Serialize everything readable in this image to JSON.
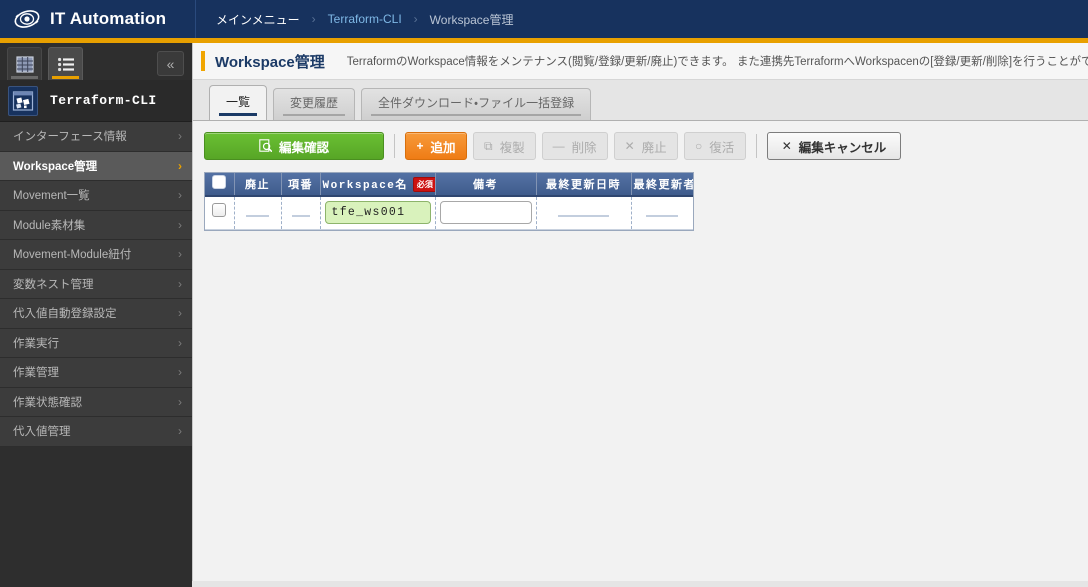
{
  "header": {
    "brand": "IT Automation",
    "logo_icon": "eye-logo-icon",
    "breadcrumb": [
      {
        "label": "メインメニュー",
        "kind": "plain"
      },
      {
        "label": "Terraform-CLI",
        "kind": "link"
      },
      {
        "label": "Workspace管理",
        "kind": "current"
      }
    ],
    "separator": "›"
  },
  "sidebar": {
    "tabs": [
      {
        "icon": "grid-view-icon",
        "active": false
      },
      {
        "icon": "list-view-icon",
        "active": true
      }
    ],
    "collapse_icon": "«",
    "section": {
      "icon": "terraform-cli-icon",
      "label": "Terraform-CLI"
    },
    "chevron": "›",
    "items": [
      {
        "label": "インターフェース情報",
        "active": false
      },
      {
        "label": "Workspace管理",
        "active": true
      },
      {
        "label": "Movement一覧",
        "active": false
      },
      {
        "label": "Module素材集",
        "active": false
      },
      {
        "label": "Movement-Module紐付",
        "active": false
      },
      {
        "label": "変数ネスト管理",
        "active": false
      },
      {
        "label": "代入値自動登録設定",
        "active": false
      },
      {
        "label": "作業実行",
        "active": false
      },
      {
        "label": "作業管理",
        "active": false
      },
      {
        "label": "作業状態確認",
        "active": false
      },
      {
        "label": "代入値管理",
        "active": false
      }
    ]
  },
  "page": {
    "title": "Workspace管理",
    "description": "TerraformのWorkspace情報をメンテナンス(閲覧/登録/更新/廃止)できます。 また連携先TerraformへWorkspacenの[登録/更新/削除]を行うことができます"
  },
  "tabs": [
    {
      "label": "一覧",
      "active": true
    },
    {
      "label": "変更履歴",
      "active": false
    },
    {
      "label": "全件ダウンロード・ファイル一括登録",
      "active": false
    }
  ],
  "toolbar": {
    "confirm": {
      "label": "編集確認",
      "icon": "🔍",
      "icon_name": "magnifier-doc-icon"
    },
    "add": {
      "label": "追加",
      "icon": "+",
      "icon_name": "plus-icon"
    },
    "duplicate": {
      "label": "複製",
      "icon": "⧉",
      "icon_name": "copy-icon"
    },
    "delete": {
      "label": "削除",
      "icon": "—",
      "icon_name": "minus-icon"
    },
    "discard": {
      "label": "廃止",
      "icon": "✕",
      "icon_name": "cross-icon"
    },
    "restore": {
      "label": "復活",
      "icon": "○",
      "icon_name": "circle-icon"
    },
    "cancel": {
      "label": "編集キャンセル",
      "icon": "✕",
      "icon_name": "cross-icon"
    }
  },
  "table": {
    "columns": [
      {
        "key": "check",
        "label": ""
      },
      {
        "key": "discard",
        "label": "廃止"
      },
      {
        "key": "no",
        "label": "項番"
      },
      {
        "key": "workspace",
        "label": "Workspace名",
        "badge": "必須"
      },
      {
        "key": "note",
        "label": "備考"
      },
      {
        "key": "updated_at",
        "label": "最終更新日時"
      },
      {
        "key": "updated_by",
        "label": "最終更新者"
      }
    ],
    "rows": [
      {
        "check": false,
        "discard": "",
        "no": "",
        "workspace": "tfe_ws001",
        "note": "",
        "updated_at": "",
        "updated_by": ""
      }
    ]
  },
  "colors": {
    "header_bg": "#17325e",
    "accent_orange": "#e8a000",
    "sidebar_bg": "#3c3c3c",
    "table_header": "#3f5c8c",
    "confirm_green": "#57a626",
    "add_orange": "#ef7c15",
    "required_red": "#cc1111",
    "input_green": "#d9f2bc"
  }
}
